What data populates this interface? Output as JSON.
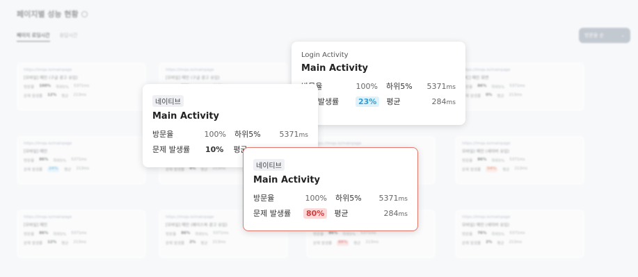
{
  "page": {
    "title": "페이지별 성능 현황",
    "tabs": [
      "페이지 로딩시간",
      "응답시간"
    ],
    "sort_label": "방문율 순"
  },
  "bg_cards": [
    {
      "url": "https://imqa.io/mainpage",
      "name": "[모바일] 메인 (구글 광고 유입)",
      "visit": "100%",
      "issue": "12%",
      "ms1": "5371ms",
      "ms2": "213ms",
      "issue_hl": ""
    },
    {
      "url": "https://imqa.io/mainpage",
      "name": "[모바일] 메인 (구글 광고 유입)",
      "visit": "86%",
      "issue": "4%",
      "ms1": "5371ms",
      "ms2": "213ms",
      "issue_hl": ""
    },
    {
      "url": "https://imqa.io/mainpage",
      "name": "[모바일] 메인",
      "visit": "86%",
      "issue": "4%",
      "ms1": "5371ms",
      "ms2": "213ms",
      "issue_hl": ""
    },
    {
      "url": "https://imqa.io/mainpage",
      "name": "[PC] 메인 화면",
      "visit": "86%",
      "issue": "0%",
      "ms1": "5371ms",
      "ms2": "213ms",
      "issue_hl": ""
    },
    {
      "url": "https://imqa.io/mainpage",
      "name": "[모바일] 메인",
      "visit": "86%",
      "issue": "24%",
      "ms1": "5371ms",
      "ms2": "213ms",
      "issue_hl": "blue"
    },
    {
      "url": "https://imqa.io/mainpage",
      "name": "[모바일] 메인",
      "visit": "86%",
      "issue": "4%",
      "ms1": "5371ms",
      "ms2": "213ms",
      "issue_hl": ""
    },
    {
      "url": "https://imqa.io/mainpage",
      "name": "[모바일] 메인",
      "visit": "86%",
      "issue": "4%",
      "ms1": "5371ms",
      "ms2": "213ms",
      "issue_hl": ""
    },
    {
      "url": "https://imqa.io/mainpage",
      "name": "모바일) 메인 (세미버 유입)",
      "visit": "86%",
      "issue": "54%",
      "ms1": "5371ms",
      "ms2": "213ms",
      "issue_hl": "orange"
    },
    {
      "url": "https://imqa.io/mainpage",
      "name": "[모바일] 메인",
      "visit": "86%",
      "issue": "12%",
      "ms1": "5371ms",
      "ms2": "213ms",
      "issue_hl": ""
    },
    {
      "url": "https://imqa.io/mainpage",
      "name": "[모바일] 메인 (페이스북 광고 유입)",
      "visit": "86%",
      "issue": "2%",
      "ms1": "5371ms",
      "ms2": "213ms",
      "issue_hl": ""
    },
    {
      "url": "https://imqa.io/mainpage",
      "name": "[모바일] 메인",
      "visit": "86%",
      "issue": "89%",
      "ms1": "5371ms",
      "ms2": "213ms",
      "issue_hl": "red"
    },
    {
      "url": "https://imqa.io/mainpage",
      "name": "모바일) 메인 (세미버 유입)",
      "visit": "76%",
      "issue": "2%",
      "ms1": "5371ms",
      "ms2": "213ms",
      "issue_hl": ""
    }
  ],
  "bg_labels": {
    "visit": "방문율",
    "issue": "문제 발생률",
    "low": "하위5%",
    "avg": "평균"
  },
  "popups": {
    "login": {
      "subtitle": "Login Activity",
      "title": "Main Activity",
      "visit_label": "방문율",
      "visit_value": "100%",
      "low_label": "하위5%",
      "low_value": "5371",
      "low_unit": "ms",
      "issue_label": "문제 발생률",
      "issue_value": "23%",
      "avg_label": "평균",
      "avg_value": "284",
      "avg_unit": "ms"
    },
    "native1": {
      "tag": "네이티브",
      "title": "Main Activity",
      "visit_label": "방문율",
      "visit_value": "100%",
      "low_label": "하위5%",
      "low_value": "5371",
      "low_unit": "ms",
      "issue_label": "문제 발생률",
      "issue_value": "10%",
      "avg_label": "평균"
    },
    "native2": {
      "tag": "네이티브",
      "title": "Main Activity",
      "visit_label": "방문율",
      "visit_value": "100%",
      "low_label": "하위5%",
      "low_value": "5371",
      "low_unit": "ms",
      "issue_label": "문제 발생률",
      "issue_value": "80%",
      "avg_label": "평균",
      "avg_value": "284",
      "avg_unit": "ms"
    }
  },
  "colors": {
    "blue_hl": "#2f9ed3",
    "red_hl": "#d33c3c",
    "orange_hl": "#e5683e",
    "active_border": "#e5776a"
  }
}
